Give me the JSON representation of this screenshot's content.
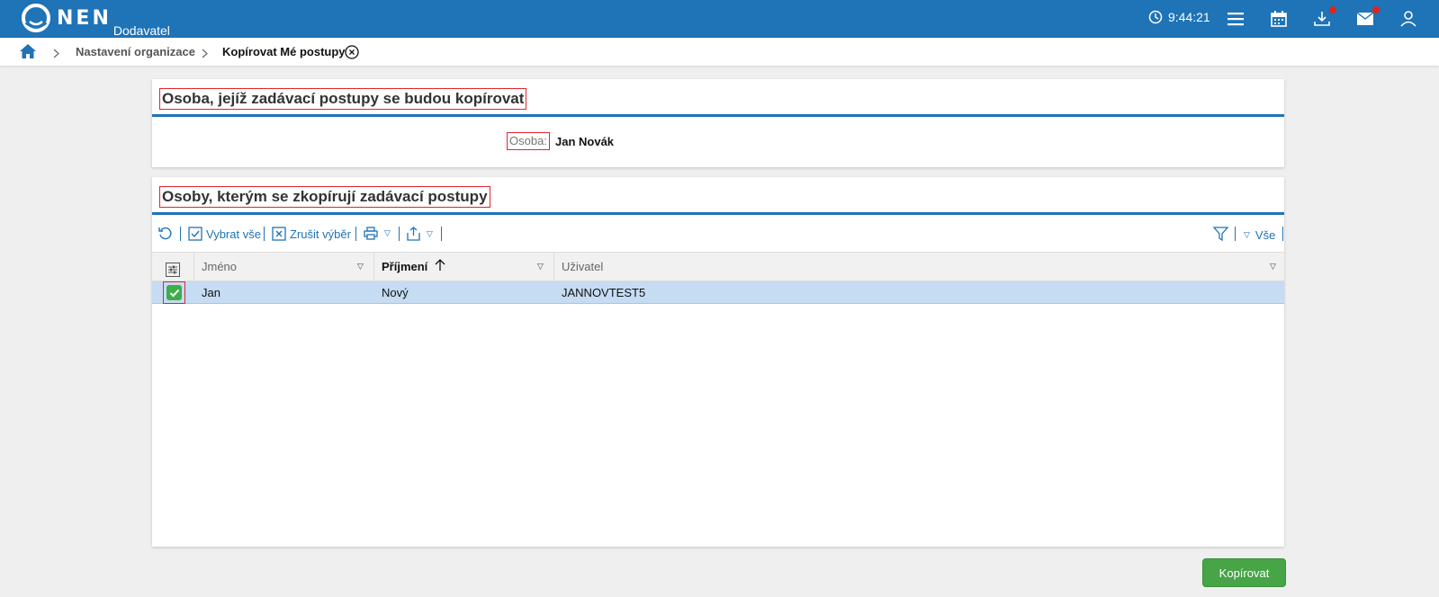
{
  "header": {
    "logo_text": "NEN",
    "logo_subtitle": "Dodavatel",
    "time": "9:44:21",
    "icons": [
      "clock-icon",
      "menu-icon",
      "calendar-icon",
      "download-icon",
      "mail-icon",
      "user-icon"
    ],
    "colors": {
      "bar": "#1f73b7",
      "notification": "#e2231a"
    }
  },
  "breadcrumb": {
    "home_icon": "home-icon",
    "items": [
      "Nastavení organizace",
      "Kopírovat Mé postupy"
    ],
    "close_icon": "close-circle-icon"
  },
  "source_panel": {
    "title": "Osoba, jejíž zadávací postupy se budou kopírovat",
    "field_label": "Osoba:",
    "field_value": "Jan Novák"
  },
  "target_panel": {
    "title": "Osoby, kterým se zkopírují zadávací postupy",
    "toolbar": {
      "refresh_icon": "refresh-icon",
      "select_all": "Vybrat vše",
      "clear_selection": "Zrušit výběr",
      "print_icon": "print-icon",
      "export_icon": "export-icon",
      "filter_icon": "filter-icon",
      "filter_value": "Vše"
    },
    "columns": [
      "Jméno",
      "Příjmení",
      "Uživatel"
    ],
    "sorted_column": "Příjmení",
    "rows": [
      {
        "jmeno": "Jan",
        "prijmeni": "Nový",
        "uzivatel": "JANNOVTEST5",
        "selected": true
      }
    ]
  },
  "actions": {
    "copy_label": "Kopírovat",
    "copy_color": "#47a447"
  }
}
